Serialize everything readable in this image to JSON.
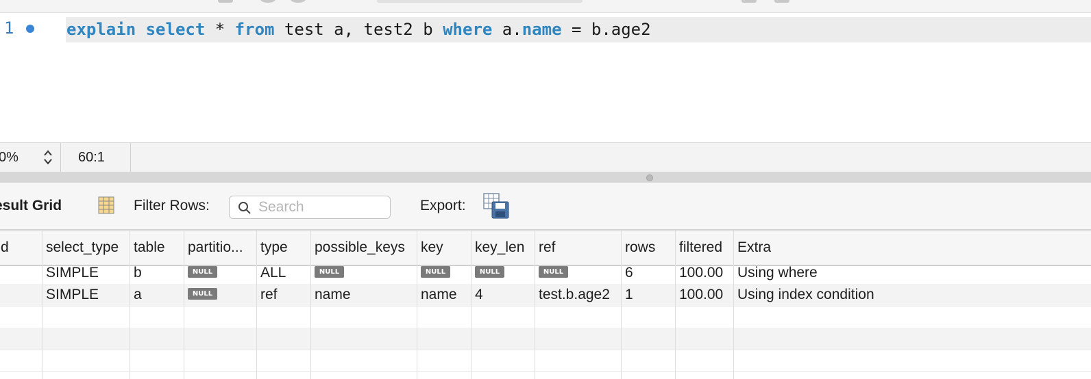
{
  "editor": {
    "line_number": "1",
    "code_tokens": [
      {
        "text": "explain",
        "kw": true
      },
      {
        "text": " ",
        "kw": false
      },
      {
        "text": "select",
        "kw": true
      },
      {
        "text": " * ",
        "kw": false
      },
      {
        "text": "from",
        "kw": true
      },
      {
        "text": " test a, test2 b ",
        "kw": false
      },
      {
        "text": "where",
        "kw": true
      },
      {
        "text": " a.",
        "kw": false
      },
      {
        "text": "name",
        "kw": true
      },
      {
        "text": " = b.age2",
        "kw": false
      }
    ]
  },
  "status": {
    "zoom": "0%",
    "cursor_position": "60:1"
  },
  "results": {
    "title": "esult Grid",
    "filter_label": "Filter Rows:",
    "search_placeholder": "Search",
    "export_label": "Export:"
  },
  "grid": {
    "columns": [
      "d",
      "select_type",
      "table",
      "partitio...",
      "type",
      "possible_keys",
      "key",
      "key_len",
      "ref",
      "rows",
      "filtered",
      "Extra"
    ],
    "null_label": "NULL",
    "rows": [
      [
        "",
        "SIMPLE",
        "b",
        null,
        "ALL",
        null,
        null,
        null,
        null,
        "6",
        "100.00",
        "Using where"
      ],
      [
        "",
        "SIMPLE",
        "a",
        null,
        "ref",
        "name",
        "name",
        "4",
        "test.b.age2",
        "1",
        "100.00",
        "Using index condition"
      ]
    ],
    "empty_rows": 3
  },
  "colors": {
    "keyword": "#2f86c0",
    "line_number": "#3a7abf",
    "breakpoint": "#3a85d6",
    "null_badge": "#7a7a7a"
  },
  "icons": [
    "breakpoint-dot-icon",
    "stepper-icon",
    "grid-view-icon",
    "search-icon",
    "export-icon"
  ]
}
